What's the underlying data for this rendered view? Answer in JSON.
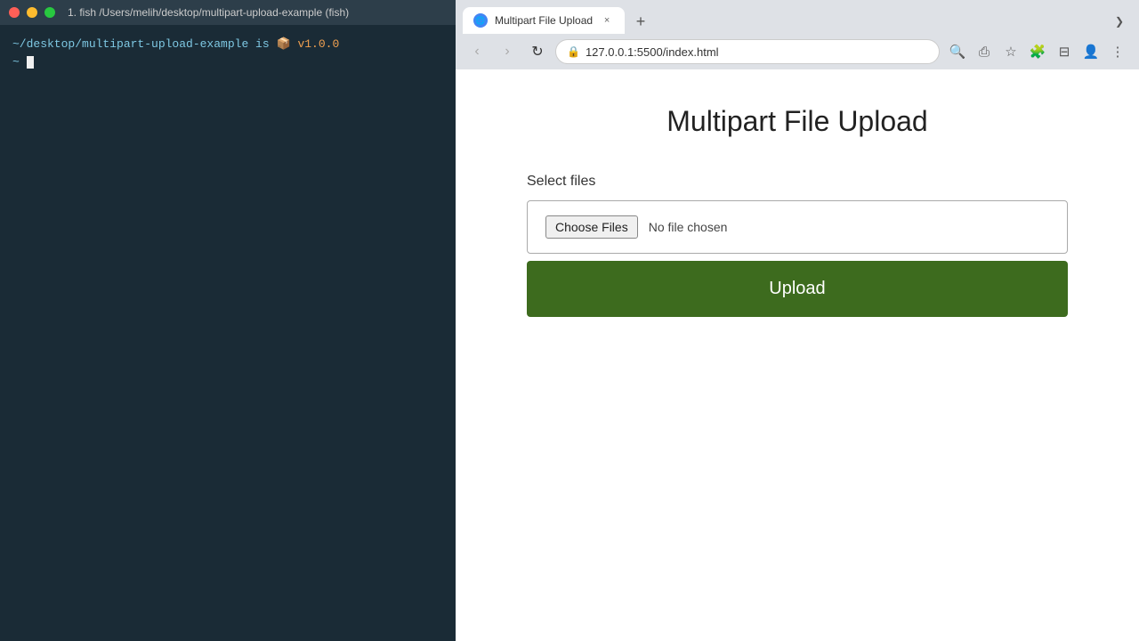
{
  "terminal": {
    "title": "1. fish /Users/melih/desktop/multipart-upload-example (fish)",
    "prompt_line": "~/desktop/multipart-upload-example is 📦 v1.0.0",
    "version_text": "v1.0.0"
  },
  "browser": {
    "tab": {
      "favicon_label": "🌐",
      "title": "Multipart File Upload",
      "close_label": "×",
      "new_tab_label": "+"
    },
    "overflow_label": "❯",
    "nav": {
      "back_label": "‹",
      "forward_label": "›",
      "refresh_label": "↻"
    },
    "address": {
      "lock_icon": "🔒",
      "url": "127.0.0.1:5500/index.html"
    },
    "toolbar": {
      "zoom_icon": "🔍",
      "share_icon": "⎙",
      "bookmark_icon": "☆",
      "extensions_icon": "🧩",
      "sidebar_icon": "⊟",
      "profile_icon": "👤",
      "menu_icon": "⋮"
    }
  },
  "page": {
    "title": "Multipart File Upload",
    "form": {
      "label": "Select files",
      "choose_files_label": "Choose Files",
      "no_file_text": "No file chosen",
      "upload_label": "Upload"
    }
  }
}
